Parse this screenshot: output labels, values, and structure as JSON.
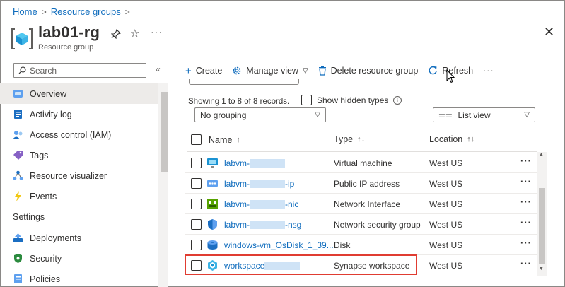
{
  "breadcrumb": {
    "home": "Home",
    "resource_groups": "Resource groups"
  },
  "header": {
    "title": "lab01-rg",
    "subtitle": "Resource group",
    "more": "···"
  },
  "search": {
    "placeholder": "Search"
  },
  "sidebar": {
    "items": [
      {
        "label": "Overview",
        "icon": "overview-icon",
        "active": true
      },
      {
        "label": "Activity log",
        "icon": "activity-log-icon"
      },
      {
        "label": "Access control (IAM)",
        "icon": "iam-icon"
      },
      {
        "label": "Tags",
        "icon": "tag-icon"
      },
      {
        "label": "Resource visualizer",
        "icon": "resource-visualizer-icon"
      },
      {
        "label": "Events",
        "icon": "lightning-icon"
      }
    ],
    "section_settings": "Settings",
    "settings_items": [
      {
        "label": "Deployments",
        "icon": "deployments-icon"
      },
      {
        "label": "Security",
        "icon": "security-icon"
      },
      {
        "label": "Policies",
        "icon": "policies-icon"
      }
    ]
  },
  "toolbar": {
    "create": "Create",
    "manage_view": "Manage view",
    "delete": "Delete resource group",
    "refresh": "Refresh",
    "more": "···"
  },
  "records": {
    "text": "Showing 1 to 8 of 8 records.",
    "show_hidden": "Show hidden types"
  },
  "grouping": {
    "value": "No grouping"
  },
  "view": {
    "value": "List view"
  },
  "table": {
    "columns": {
      "name": "Name",
      "type": "Type",
      "location": "Location"
    },
    "rows": [
      {
        "name_prefix": "labvm-",
        "name_suffix": "",
        "type": "Virtual machine",
        "location": "West US",
        "icon": "virtual-machine-icon"
      },
      {
        "name_prefix": "labvm-",
        "name_suffix": "-ip",
        "type": "Public IP address",
        "location": "West US",
        "icon": "public-ip-icon"
      },
      {
        "name_prefix": "labvm-",
        "name_suffix": "-nic",
        "type": "Network Interface",
        "location": "West US",
        "icon": "network-interface-icon"
      },
      {
        "name_prefix": "labvm-",
        "name_suffix": "-nsg",
        "type": "Network security group",
        "location": "West US",
        "icon": "nsg-icon"
      },
      {
        "name_prefix": "windows-vm_OsDisk_1_39...",
        "name_suffix": "",
        "type": "Disk",
        "location": "West US",
        "icon": "disk-icon"
      },
      {
        "name_prefix": "workspace",
        "name_suffix": "",
        "type": "Synapse workspace",
        "location": "West US",
        "icon": "synapse-icon",
        "highlighted": true
      }
    ],
    "row_more": "···"
  },
  "colors": {
    "link": "#0f6cbd",
    "highlight": "#e03c31"
  }
}
